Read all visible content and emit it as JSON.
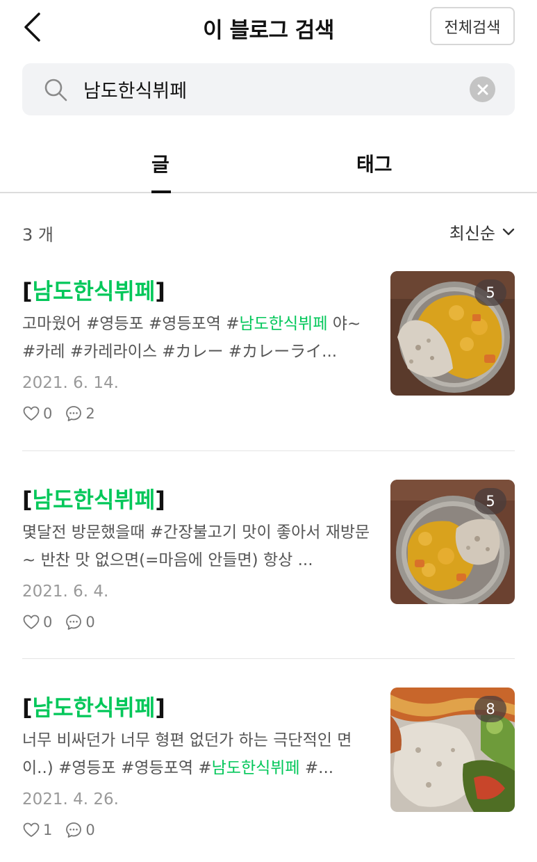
{
  "header": {
    "title": "이 블로그 검색",
    "all_search_label": "전체검색"
  },
  "search": {
    "value": "남도한식뷔페",
    "placeholder": ""
  },
  "tabs": [
    {
      "label": "글",
      "active": true
    },
    {
      "label": "태그",
      "active": false
    }
  ],
  "results": {
    "count_label": "3 개",
    "sort_label": "최신순"
  },
  "posts": [
    {
      "title_prefix": "[",
      "title_highlight": "남도한식뷔페",
      "title_suffix": "]",
      "excerpt_before": "고마웠어 #영등포 #영등포역 #",
      "excerpt_highlight": "남도한식뷔페",
      "excerpt_after": " 야~ #카레 #카레라이스 #カレー #カレーライ...",
      "date": "2021. 6. 14.",
      "likes": "0",
      "comments": "2",
      "image_count": "5"
    },
    {
      "title_prefix": "[",
      "title_highlight": "남도한식뷔페",
      "title_suffix": "]",
      "excerpt_before": "몇달전 방문했을때 #간장불고기 맛이 좋아서 재방문~ 반찬 맛 없으면(=마음에 안들면) 항상 ...",
      "excerpt_highlight": "",
      "excerpt_after": "",
      "date": "2021. 6. 4.",
      "likes": "0",
      "comments": "0",
      "image_count": "5"
    },
    {
      "title_prefix": "[",
      "title_highlight": "남도한식뷔페",
      "title_suffix": "]",
      "excerpt_before": "너무 비싸던가 너무 형편 없던가 하는 극단적인 면 이..) #영등포 #영등포역 #",
      "excerpt_highlight": "남도한식뷔페",
      "excerpt_after": " #...",
      "date": "2021. 4. 26.",
      "likes": "1",
      "comments": "0",
      "image_count": "8"
    }
  ],
  "colors": {
    "accent": "#03c75a",
    "text": "#111111",
    "muted": "#999999"
  }
}
